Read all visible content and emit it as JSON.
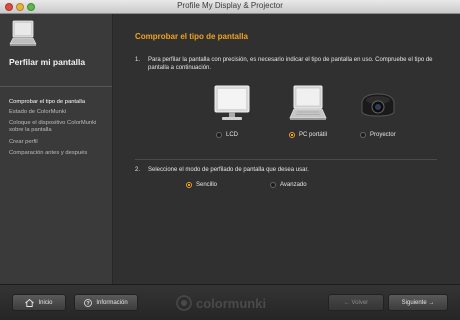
{
  "window": {
    "title": "Profile My Display & Projector"
  },
  "sidebar": {
    "heading": "Perfilar mi pantalla",
    "steps": [
      {
        "label": "Comprobar el tipo de pantalla",
        "active": true
      },
      {
        "label": "Estado de ColorMunki",
        "active": false
      },
      {
        "label": "Coloque el dispositivo ColorMunki sobre la pantalla",
        "active": false
      },
      {
        "label": "Crear perfil",
        "active": false
      },
      {
        "label": "Comparación antes y después",
        "active": false
      }
    ]
  },
  "main": {
    "title": "Comprobar el tipo de pantalla",
    "instruction1": {
      "number": "1.",
      "text": "Para perfilar la pantalla con precisión, es necesario indicar el tipo de pantalla en uso. Compruebe el tipo de pantalla a continuación."
    },
    "devices": [
      {
        "label": "LCD",
        "icon": "lcd-monitor-icon",
        "selected": false
      },
      {
        "label": "PC portátil",
        "icon": "laptop-icon",
        "selected": true
      },
      {
        "label": "Proyector",
        "icon": "projector-icon",
        "selected": false
      }
    ],
    "instruction2": {
      "number": "2.",
      "text": "Seleccione el modo de perfilado de pantalla que desea usar."
    },
    "modes": [
      {
        "label": "Sencillo",
        "selected": true
      },
      {
        "label": "Avanzado",
        "selected": false
      }
    ]
  },
  "bottom": {
    "home_label": "Inicio",
    "info_label": "Información",
    "brand": "colormunki",
    "back_label": "← Volver",
    "next_label": "Siguiente →"
  },
  "colors": {
    "accent": "#f0a21e",
    "background": "#303030",
    "sidebar": "#3a3a3a"
  }
}
